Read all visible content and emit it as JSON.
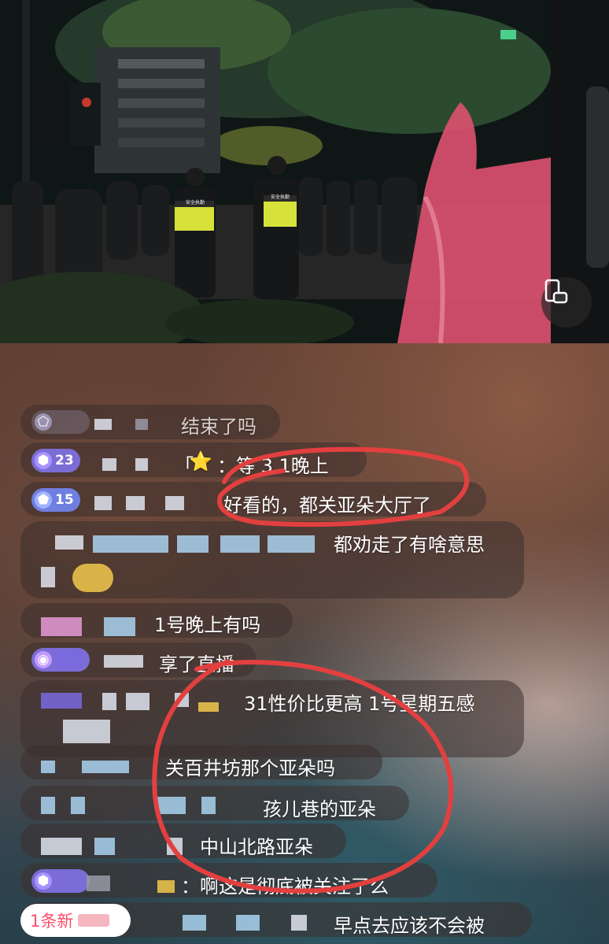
{
  "comments": [
    {
      "badge": "",
      "text": "结束了吗"
    },
    {
      "badge": "23",
      "prefix": "「",
      "star": "⭐",
      "text": "：等 3  1晚上"
    },
    {
      "badge": "15",
      "text": "好看的，都关亚朵大厅了"
    },
    {
      "badge": "",
      "text": "都劝走了有啥意思"
    },
    {
      "badge": "",
      "text": "1号晚上有吗"
    },
    {
      "badge": "",
      "text": "享了直播"
    },
    {
      "badge": "",
      "text": "31性价比更高 1号星期五感"
    },
    {
      "badge": "",
      "text": "关百井坊那个亚朵吗"
    },
    {
      "badge": "",
      "text": "孩儿巷的亚朵"
    },
    {
      "badge": "",
      "text": "中山北路亚朵"
    },
    {
      "badge": "",
      "text": "：啊这是彻底被关注了么"
    },
    {
      "badge": "",
      "text": "早点去应该不会被"
    }
  ],
  "vest_text": "安全执勤",
  "new_messages": "1条新",
  "icons": {
    "screen_toggle": "phone-rotate-icon",
    "badge_gem": "gem-icon"
  },
  "colors": {
    "annotation": "#e2403f",
    "new_message_text": "#ff4d6a"
  }
}
